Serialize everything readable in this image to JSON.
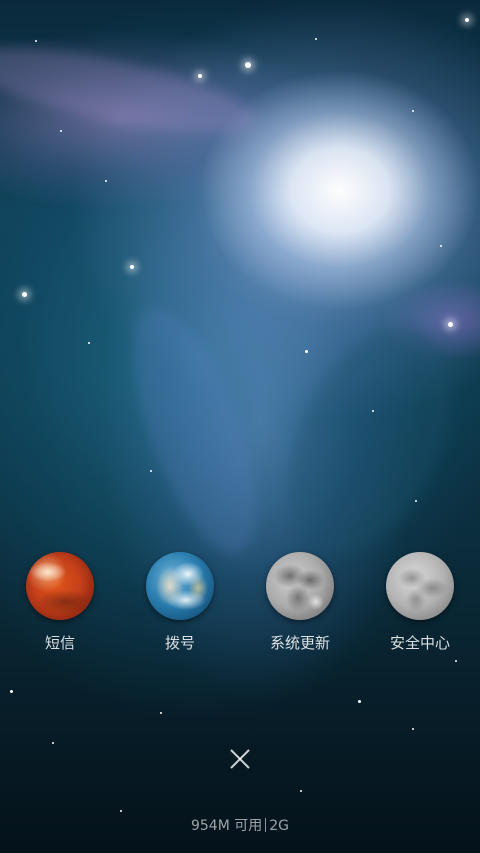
{
  "shortcuts": [
    {
      "label": "短信",
      "icon": "mars-planet-icon"
    },
    {
      "label": "拨号",
      "icon": "earth-planet-icon"
    },
    {
      "label": "系统更新",
      "icon": "moon-planet-icon"
    },
    {
      "label": "安全中心",
      "icon": "moon-planet-icon"
    }
  ],
  "close": {
    "icon": "close-icon"
  },
  "memory": {
    "available": "954M 可用",
    "total": "2G"
  },
  "colors": {
    "label_text": "#ffffff",
    "background_deep": "#06121a",
    "nebula_teal": "#103d55"
  }
}
